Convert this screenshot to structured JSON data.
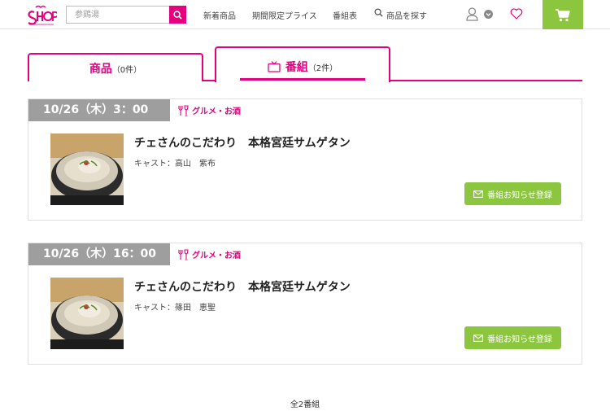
{
  "header": {
    "search_placeholder": "参鶏湯",
    "nav": [
      "新着商品",
      "期間限定プライス",
      "番組表",
      "商品を探す"
    ]
  },
  "tabs": [
    {
      "label": "商品",
      "count": "（0件）"
    },
    {
      "label": "番組",
      "count": "（2件）"
    }
  ],
  "programs": [
    {
      "time": "10/26（木）3：00",
      "genre": "グルメ・お酒",
      "title": "チェさんのこだわり　本格宮廷サムゲタン",
      "cast": "キャスト：高山　紫布",
      "button": "番組お知らせ登録"
    },
    {
      "time": "10/26（木）16：00",
      "genre": "グルメ・お酒",
      "title": "チェさんのこだわり　本格宮廷サムゲタン",
      "cast": "キャスト：篠田　恵聖",
      "button": "番組お知らせ登録"
    }
  ],
  "footer": {
    "total": "全2番組"
  },
  "colors": {
    "brand": "#e4007f",
    "accent_green": "#8cc63f",
    "time_bg": "#9e9e9e"
  }
}
